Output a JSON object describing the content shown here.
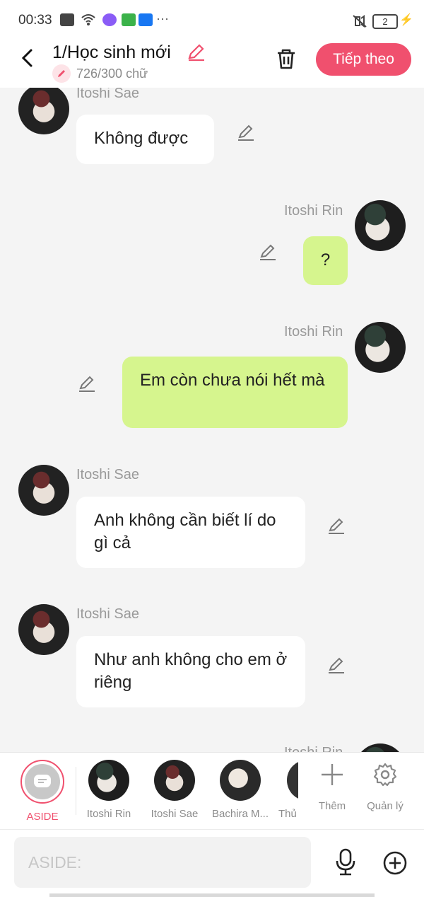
{
  "status": {
    "time": "00:33",
    "battery": "2"
  },
  "header": {
    "title": "1/Học sinh mới",
    "word_count": "726/300 chữ",
    "next_label": "Tiếp theo"
  },
  "colors": {
    "accent": "#f0506e",
    "bubble_right": "#d6f58e",
    "bubble_left": "#ffffff"
  },
  "messages": [
    {
      "sender": "Itoshi Sae",
      "side": "left",
      "text": "Không được"
    },
    {
      "sender": "Itoshi Rin",
      "side": "right",
      "text": "?"
    },
    {
      "sender": "Itoshi Rin",
      "side": "right",
      "text": "Em còn chưa nói hết mà"
    },
    {
      "sender": "Itoshi Sae",
      "side": "left",
      "text": "Anh không cần biết lí do gì cả"
    },
    {
      "sender": "Itoshi Sae",
      "side": "left",
      "text": "Như anh không cho em ở riêng"
    },
    {
      "sender": "Itoshi Rin",
      "side": "right",
      "text": ""
    }
  ],
  "characters": {
    "aside": "ASIDE",
    "items": [
      "Itoshi Rin",
      "Itoshi Sae",
      "Bachira M...",
      "Thủ"
    ],
    "more": "Thêm",
    "manage": "Quản lý"
  },
  "input": {
    "placeholder": "ASIDE:"
  }
}
